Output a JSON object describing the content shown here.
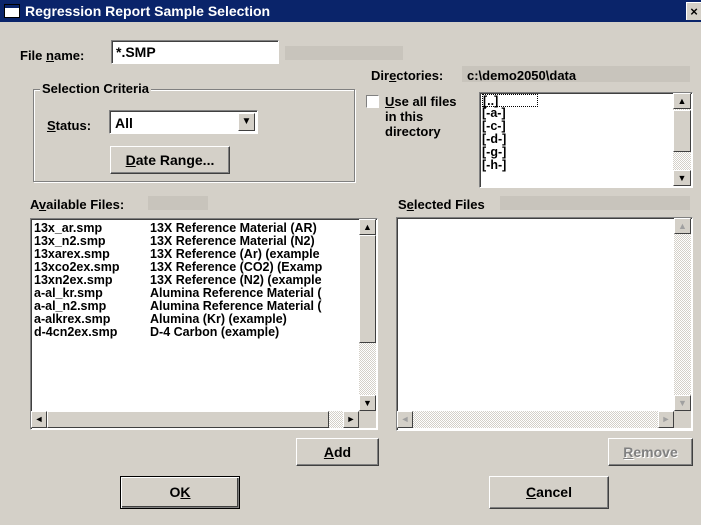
{
  "window": {
    "title": "Regression Report Sample Selection",
    "close_glyph": "×"
  },
  "file_name": {
    "label_pre": "File ",
    "label_key": "n",
    "label_post": "ame:",
    "value": "*.SMP"
  },
  "directories": {
    "label_pre": "Dir",
    "label_key": "e",
    "label_post": "ctories:",
    "path": "c:\\demo2050\\data"
  },
  "selection_criteria": {
    "title": "Selection Criteria",
    "status_label_key": "S",
    "status_label_post": "tatus:",
    "status_value": "All",
    "date_range_key": "D",
    "date_range_post": "ate Range..."
  },
  "use_all_files": {
    "key": "U",
    "line1_post": "se all files",
    "line2": "in this",
    "line3": "directory",
    "checked": false
  },
  "dir_list": [
    "[..]",
    "[-a-]",
    "[-c-]",
    "[-d-]",
    "[-g-]",
    "[-h-]"
  ],
  "available_files": {
    "label_pre": "A",
    "label_key": "v",
    "label_post": "ailable Files:",
    "rows": [
      {
        "file": "13x_ar.smp",
        "desc": "13X Reference Material (AR)"
      },
      {
        "file": "13x_n2.smp",
        "desc": "13X Reference Material (N2)"
      },
      {
        "file": "13xarex.smp",
        "desc": "13X Reference (Ar) (example"
      },
      {
        "file": "13xco2ex.smp",
        "desc": "13X Reference (CO2) (Examp"
      },
      {
        "file": "13xn2ex.smp",
        "desc": "13X Reference (N2) (example"
      },
      {
        "file": "a-al_kr.smp",
        "desc": "Alumina Reference Material ("
      },
      {
        "file": "a-al_n2.smp",
        "desc": "Alumina Reference Material ("
      },
      {
        "file": "a-alkrex.smp",
        "desc": "Alumina (Kr) (example)"
      },
      {
        "file": "d-4cn2ex.smp",
        "desc": "D-4 Carbon (example)"
      }
    ]
  },
  "selected_files": {
    "label_pre": "S",
    "label_key": "e",
    "label_post": "lected Files"
  },
  "buttons": {
    "add_key": "A",
    "add_post": "dd",
    "remove_key": "R",
    "remove_post": "emove",
    "ok_pre": "O",
    "ok_key": "K",
    "cancel_key": "C",
    "cancel_post": "ancel"
  },
  "icons": {
    "up": "▲",
    "down": "▼",
    "left": "◄",
    "right": "►",
    "dropdown": "▼"
  }
}
